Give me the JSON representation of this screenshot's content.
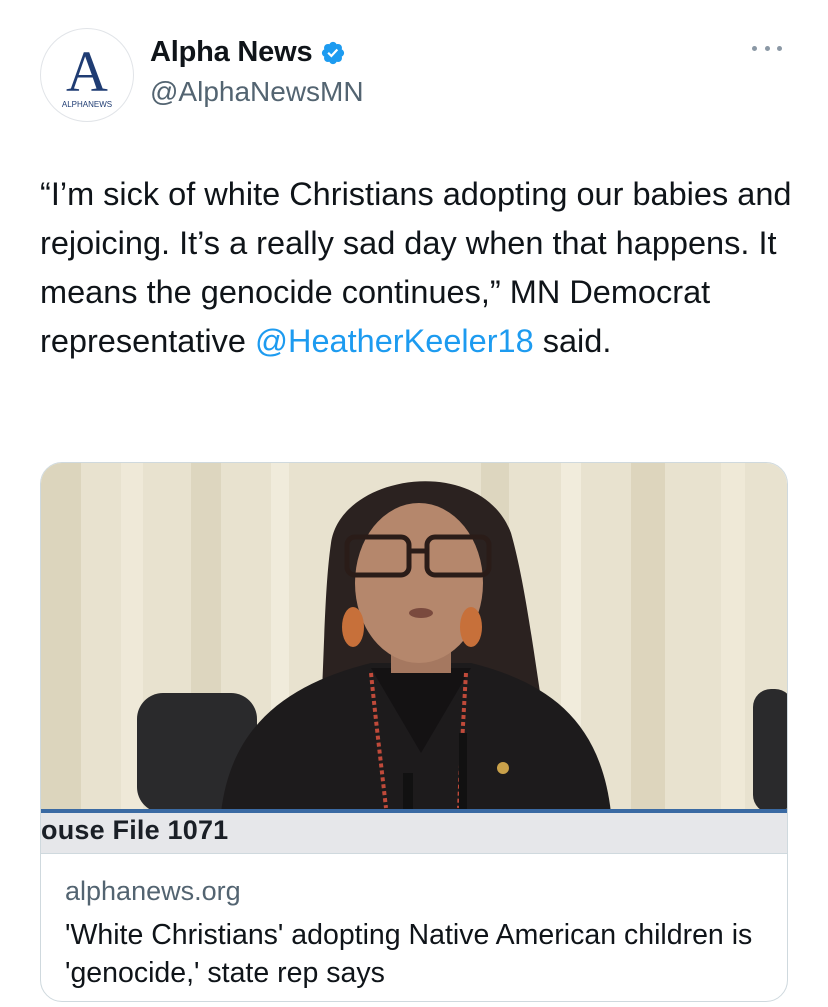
{
  "tweet": {
    "author": {
      "display_name": "Alpha News",
      "handle": "@AlphaNewsMN",
      "verified": true,
      "avatar_letter": "A",
      "avatar_caption": "ALPHANEWS"
    },
    "text_before_mention": "“I’m sick of white Christians adopting our babies and rejoicing. It’s a really sad day when that happens. It means the genocide continues,” MN Democrat representative ",
    "mention": "@HeatherKeeler18",
    "text_after_mention": " said.",
    "more_icon": "ellipsis-icon"
  },
  "link_card": {
    "image_caption": "ouse File 1071",
    "domain": "alphanews.org",
    "title": "'White Christians' adopting Native American children is 'genocide,' state rep says"
  },
  "colors": {
    "link": "#1d9bf0",
    "verified": "#1d9bf0",
    "secondary_text": "#536471",
    "caption_stripe": "#3a6aa3"
  }
}
